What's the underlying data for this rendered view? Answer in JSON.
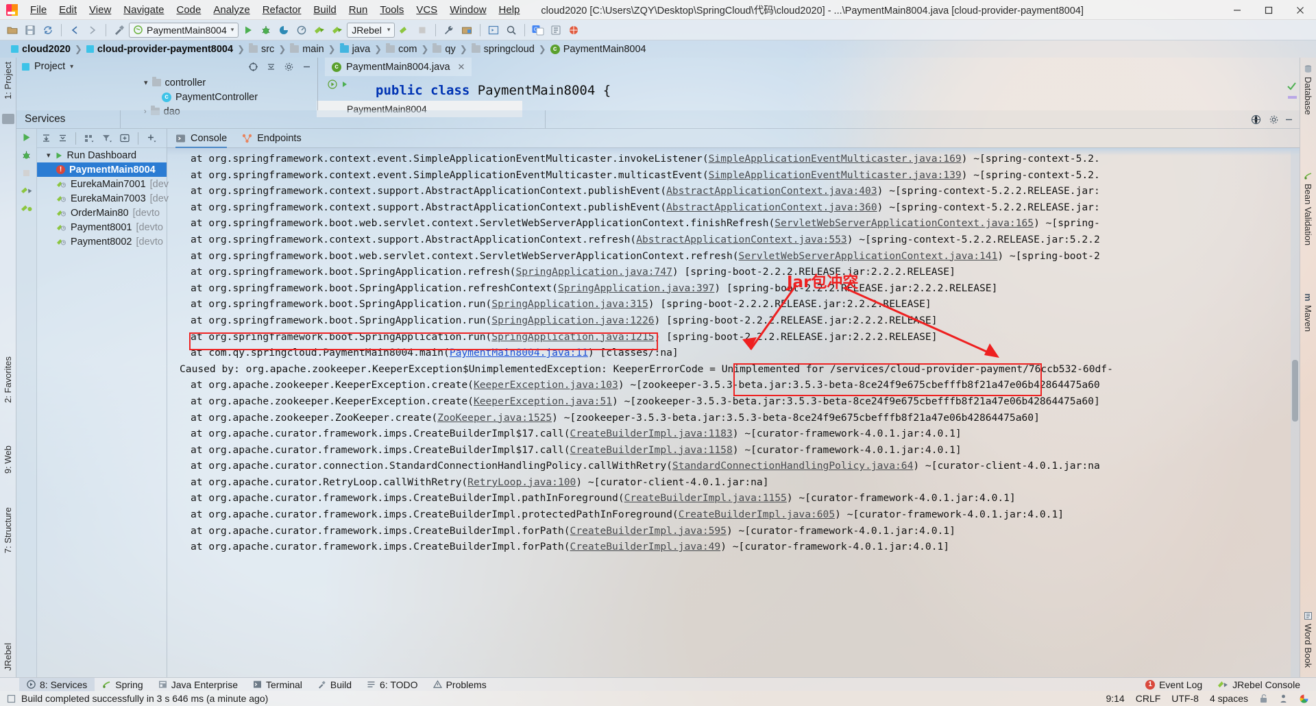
{
  "window": {
    "title": "cloud2020 [C:\\Users\\ZQY\\Desktop\\SpringCloud\\代码\\cloud2020] - ...\\PaymentMain8004.java [cloud-provider-payment8004]",
    "minimize": "—",
    "maximize": "▢",
    "close": "✕"
  },
  "menu": [
    {
      "label": "File"
    },
    {
      "label": "Edit"
    },
    {
      "label": "View"
    },
    {
      "label": "Navigate"
    },
    {
      "label": "Code"
    },
    {
      "label": "Analyze"
    },
    {
      "label": "Refactor"
    },
    {
      "label": "Build"
    },
    {
      "label": "Run"
    },
    {
      "label": "Tools"
    },
    {
      "label": "VCS"
    },
    {
      "label": "Window"
    },
    {
      "label": "Help"
    }
  ],
  "toolbar": {
    "run_config": "PaymentMain8004",
    "jrebel": "JRebel",
    "caret": "▾"
  },
  "breadcrumb": [
    {
      "label": "cloud2020",
      "icon": "module-icon",
      "bold": true
    },
    {
      "label": "cloud-provider-payment8004",
      "icon": "module-icon",
      "bold": true
    },
    {
      "label": "src",
      "icon": "folder-icon",
      "bold": false
    },
    {
      "label": "main",
      "icon": "folder-icon",
      "bold": false
    },
    {
      "label": "java",
      "icon": "folder-blue-icon",
      "bold": false
    },
    {
      "label": "com",
      "icon": "folder-icon",
      "bold": false
    },
    {
      "label": "qy",
      "icon": "folder-icon",
      "bold": false
    },
    {
      "label": "springcloud",
      "icon": "folder-icon",
      "bold": false
    },
    {
      "label": "PaymentMain8004",
      "icon": "class-icon",
      "bold": false
    }
  ],
  "left_rail": [
    {
      "label": "1: Project"
    },
    {
      "label": "2: Favorites"
    },
    {
      "label": "9: Web"
    },
    {
      "label": "7: Structure"
    },
    {
      "label": "JRebel"
    }
  ],
  "right_rail": [
    {
      "label": "Database",
      "icon": "database-icon"
    },
    {
      "label": "Bean Validation",
      "icon": "bean-icon"
    },
    {
      "label": "Maven",
      "icon": "maven-icon"
    },
    {
      "label": "Word Book",
      "icon": "book-icon"
    }
  ],
  "project_window": {
    "title": "Project",
    "caret": "▾",
    "tree": [
      {
        "label": "controller",
        "icon": "folder-icon",
        "arrow": "▾",
        "indent": 1
      },
      {
        "label": "PaymentController",
        "icon": "class-icon",
        "arrow": "",
        "indent": 2
      },
      {
        "label": "dao",
        "icon": "folder-icon",
        "arrow": "›",
        "indent": 1
      }
    ]
  },
  "editor": {
    "tab_label": "PaymentMain8004.java",
    "tab_close": "✕",
    "code_kw": "public class",
    "code_rest": " PaymentMain8004 {",
    "tooltip": "PaymentMain8004"
  },
  "services": {
    "title": "Services",
    "list_toolbar_icons": [
      "expand-all-icon",
      "collapse-all-icon",
      "group-icon",
      "filter-icon",
      "add-tab-icon",
      "add-icon"
    ],
    "side_icons": [
      "run-icon",
      "debug-icon",
      "stop-icon",
      "rerun-icon",
      "rerun2-icon"
    ],
    "items": [
      {
        "label": "Run Dashboard",
        "suffix": "",
        "icon": "run-green-icon",
        "arrow": "▾",
        "level": 0,
        "selected": false
      },
      {
        "label": "PaymentMain8004",
        "suffix": "",
        "icon": "error-icon",
        "arrow": "",
        "level": 1,
        "selected": true
      },
      {
        "label": "EurekaMain7001",
        "suffix": " [dev",
        "icon": "rocket-icon",
        "arrow": "",
        "level": 1,
        "selected": false
      },
      {
        "label": "EurekaMain7003",
        "suffix": " [dev",
        "icon": "rocket-icon",
        "arrow": "",
        "level": 1,
        "selected": false
      },
      {
        "label": "OrderMain80",
        "suffix": " [devto",
        "icon": "rocket-icon",
        "arrow": "",
        "level": 1,
        "selected": false
      },
      {
        "label": "Payment8001",
        "suffix": " [devto",
        "icon": "rocket-icon",
        "arrow": "",
        "level": 1,
        "selected": false
      },
      {
        "label": "Payment8002",
        "suffix": " [devto",
        "icon": "rocket-icon",
        "arrow": "",
        "level": 1,
        "selected": false
      }
    ],
    "tabs": [
      {
        "label": "Console",
        "icon": "console-icon",
        "active": true
      },
      {
        "label": "Endpoints",
        "icon": "endpoints-icon",
        "active": false
      }
    ]
  },
  "console_lines": [
    {
      "indent": 1,
      "text": "at org.springframework.context.event.SimpleApplicationEventMulticaster.invokeListener(",
      "link": "SimpleApplicationEventMulticaster.java:169",
      "tail": ") ~[spring-context-5.2."
    },
    {
      "indent": 1,
      "text": "at org.springframework.context.event.SimpleApplicationEventMulticaster.multicastEvent(",
      "link": "SimpleApplicationEventMulticaster.java:139",
      "tail": ") ~[spring-context-5.2."
    },
    {
      "indent": 1,
      "text": "at org.springframework.context.support.AbstractApplicationContext.publishEvent(",
      "link": "AbstractApplicationContext.java:403",
      "tail": ") ~[spring-context-5.2.2.RELEASE.jar:"
    },
    {
      "indent": 1,
      "text": "at org.springframework.context.support.AbstractApplicationContext.publishEvent(",
      "link": "AbstractApplicationContext.java:360",
      "tail": ") ~[spring-context-5.2.2.RELEASE.jar:"
    },
    {
      "indent": 1,
      "text": "at org.springframework.boot.web.servlet.context.ServletWebServerApplicationContext.finishRefresh(",
      "link": "ServletWebServerApplicationContext.java:165",
      "tail": ") ~[spring-"
    },
    {
      "indent": 1,
      "text": "at org.springframework.context.support.AbstractApplicationContext.refresh(",
      "link": "AbstractApplicationContext.java:553",
      "tail": ") ~[spring-context-5.2.2.RELEASE.jar:5.2.2"
    },
    {
      "indent": 1,
      "text": "at org.springframework.boot.web.servlet.context.ServletWebServerApplicationContext.refresh(",
      "link": "ServletWebServerApplicationContext.java:141",
      "tail": ") ~[spring-boot-2"
    },
    {
      "indent": 1,
      "text": "at org.springframework.boot.SpringApplication.refresh(",
      "link": "SpringApplication.java:747",
      "tail": ") [spring-boot-2.2.2.RELEASE.jar:2.2.2.RELEASE]"
    },
    {
      "indent": 1,
      "text": "at org.springframework.boot.SpringApplication.refreshContext(",
      "link": "SpringApplication.java:397",
      "tail": ") [spring-boot-2.2.2.RELEASE.jar:2.2.2.RELEASE]"
    },
    {
      "indent": 1,
      "text": "at org.springframework.boot.SpringApplication.run(",
      "link": "SpringApplication.java:315",
      "tail": ") [spring-boot-2.2.2.RELEASE.jar:2.2.2.RELEASE]"
    },
    {
      "indent": 1,
      "text": "at org.springframework.boot.SpringApplication.run(",
      "link": "SpringApplication.java:1226",
      "tail": ") [spring-boot-2.2.2.RELEASE.jar:2.2.2.RELEASE]"
    },
    {
      "indent": 1,
      "text": "at org.springframework.boot.SpringApplication.run(",
      "link": "SpringApplication.java:1215",
      "tail": ") [spring-boot-2.2.2.RELEASE.jar:2.2.2.RELEASE]"
    },
    {
      "indent": 1,
      "text": "at com.qy.springcloud.PaymentMain8004.main(",
      "link": "PaymentMain8004.java:11",
      "tail": ") [classes/:na]",
      "boxed": true,
      "linkblue": true
    },
    {
      "indent": 0,
      "text": "Caused by: org.apache.zookeeper.KeeperException$UnimplementedException: KeeperErrorCode = Unimplemented for /services/cloud-provider-payment/76ccb532-60df-",
      "link": "",
      "tail": ""
    },
    {
      "indent": 1,
      "text": "at org.apache.zookeeper.KeeperException.create(",
      "link": "KeeperException.java:103",
      "tail": ") ~[zookeeper-3.5.3-beta.jar:3.5.3-beta-8ce24f9e675cbefffb8f21a47e06b42864475a60"
    },
    {
      "indent": 1,
      "text": "at org.apache.zookeeper.KeeperException.create(",
      "link": "KeeperException.java:51",
      "tail": ") ~[zookeeper-3.5.3-beta.jar:3.5.3-beta-8ce24f9e675cbefffb8f21a47e06b42864475a60]"
    },
    {
      "indent": 1,
      "text": "at org.apache.zookeeper.ZooKeeper.create(",
      "link": "ZooKeeper.java:1525",
      "tail": ") ~[zookeeper-3.5.3-beta.jar:3.5.3-beta-8ce24f9e675cbefffb8f21a47e06b42864475a60]"
    },
    {
      "indent": 1,
      "text": "at org.apache.curator.framework.imps.CreateBuilderImpl$17.call(",
      "link": "CreateBuilderImpl.java:1183",
      "tail": ") ~[curator-framework-4.0.1.jar:4.0.1]"
    },
    {
      "indent": 1,
      "text": "at org.apache.curator.framework.imps.CreateBuilderImpl$17.call(",
      "link": "CreateBuilderImpl.java:1158",
      "tail": ") ~[curator-framework-4.0.1.jar:4.0.1]"
    },
    {
      "indent": 1,
      "text": "at org.apache.curator.connection.StandardConnectionHandlingPolicy.callWithRetry(",
      "link": "StandardConnectionHandlingPolicy.java:64",
      "tail": ") ~[curator-client-4.0.1.jar:na"
    },
    {
      "indent": 1,
      "text": "at org.apache.curator.RetryLoop.callWithRetry(",
      "link": "RetryLoop.java:100",
      "tail": ") ~[curator-client-4.0.1.jar:na]"
    },
    {
      "indent": 1,
      "text": "at org.apache.curator.framework.imps.CreateBuilderImpl.pathInForeground(",
      "link": "CreateBuilderImpl.java:1155",
      "tail": ") ~[curator-framework-4.0.1.jar:4.0.1]"
    },
    {
      "indent": 1,
      "text": "at org.apache.curator.framework.imps.CreateBuilderImpl.protectedPathInForeground(",
      "link": "CreateBuilderImpl.java:605",
      "tail": ") ~[curator-framework-4.0.1.jar:4.0.1]"
    },
    {
      "indent": 1,
      "text": "at org.apache.curator.framework.imps.CreateBuilderImpl.forPath(",
      "link": "CreateBuilderImpl.java:595",
      "tail": ") ~[curator-framework-4.0.1.jar:4.0.1]"
    },
    {
      "indent": 1,
      "text": "at org.apache.curator.framework.imps.CreateBuilderImpl.forPath(",
      "link": "CreateBuilderImpl.java:49",
      "tail": ") ~[curator-framework-4.0.1.jar:4.0.1]"
    }
  ],
  "annotation": {
    "label": "Jar包冲突",
    "color": "#ee2020"
  },
  "bottom_bar": {
    "left_items": [
      {
        "label": "8: Services",
        "icon": "services-icon",
        "active": true
      },
      {
        "label": "Spring",
        "icon": "spring-icon",
        "active": false
      },
      {
        "label": "Java Enterprise",
        "icon": "javaee-icon",
        "active": false
      },
      {
        "label": "Terminal",
        "icon": "terminal-icon",
        "active": false
      },
      {
        "label": "Build",
        "icon": "build-icon",
        "active": false
      },
      {
        "label": "6: TODO",
        "icon": "todo-icon",
        "active": false
      },
      {
        "label": "Problems",
        "icon": "problems-icon",
        "active": false
      }
    ],
    "right_items": [
      {
        "label": "Event Log",
        "icon": "event-log-icon",
        "badge": "1"
      },
      {
        "label": "JRebel Console",
        "icon": "jrebel-icon",
        "badge": ""
      }
    ]
  },
  "status_bar": {
    "message": "Build completed successfully in 3 s 646 ms (a minute ago)",
    "position": "9:14",
    "line_sep": "CRLF",
    "encoding": "UTF-8",
    "indent": "4 spaces",
    "lock_icon": "unlocked-icon",
    "inspection_icon": "inspector-icon",
    "google_icon": "google-icon"
  }
}
